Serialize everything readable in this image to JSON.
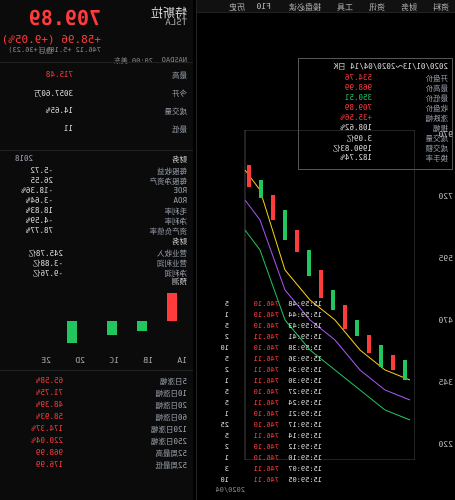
{
  "header": {
    "name": "特斯拉",
    "symbol": "TSLA",
    "price": "709.89",
    "change": "+58.96 (+9.05%)",
    "after_hours": "746.12 +5.10% (+36.23)",
    "after_hours_label": "盘后",
    "market": "NASDAQ",
    "session_time": "20:00 美东"
  },
  "quote_stats": [
    {
      "label": "最高",
      "value": "715.48",
      "cls": "red"
    },
    {
      "label": "今开",
      "value": "3057.60万",
      "cls": "white"
    },
    {
      "label": "成交量",
      "value": "14.65%",
      "cls": "white"
    },
    {
      "label": "最低",
      "value": "11",
      "cls": "white"
    }
  ],
  "chart_toolbar": [
    "资料",
    "财务",
    "资讯",
    "工具",
    "操盘必读",
    "F10",
    "历史"
  ],
  "chart_info": {
    "title": "2020/01/13～2020/04/14 日K",
    "rows": [
      {
        "k": "开盘价",
        "v": "534.76",
        "cls": "red"
      },
      {
        "k": "最高价",
        "v": "968.99",
        "cls": "red"
      },
      {
        "k": "最低价",
        "v": "350.51",
        "cls": "green"
      },
      {
        "k": "收盘价",
        "v": "709.89",
        "cls": "red"
      },
      {
        "k": "涨跌幅",
        "v": "+35.56%",
        "cls": "red"
      },
      {
        "k": "振幅",
        "v": "108.62%",
        "cls": "white"
      },
      {
        "k": "成交量",
        "v": "3.09亿",
        "cls": "white"
      },
      {
        "k": "成交额",
        "v": "1990.83亿",
        "cls": "white"
      },
      {
        "k": "换手率",
        "v": "182.74%",
        "cls": "white"
      }
    ]
  },
  "y_axis": [
    "970",
    "720",
    "595",
    "470",
    "345",
    "220"
  ],
  "x_axis": "2020/04",
  "left_panel": {
    "section1": "财务",
    "year": "2018",
    "fin_rows": [
      {
        "k": "每股收益",
        "v": "-5.72"
      },
      {
        "k": "每股净资产",
        "v": "26.55"
      },
      {
        "k": "ROE",
        "v": "-18.36%"
      },
      {
        "k": "ROA",
        "v": "-3.64%"
      },
      {
        "k": "毛利率",
        "v": "18.83%"
      },
      {
        "k": "净利率",
        "v": "-4.59%"
      },
      {
        "k": "资产负债率",
        "v": "78.77%"
      }
    ],
    "section2": "财务",
    "profit_rows": [
      {
        "k": "营业收入",
        "v": "245.78亿"
      },
      {
        "k": "营业利润",
        "v": "-3.88亿"
      },
      {
        "k": "净利润",
        "v": "-9.76亿"
      }
    ],
    "section3": "预测",
    "forecast_years": [
      "2019",
      "2020",
      "2021",
      "2022"
    ],
    "eps_tabs": [
      "1A",
      "1B",
      "1C",
      "2D",
      "2E"
    ],
    "returns": [
      {
        "k": "5日涨幅",
        "v": "65.58%"
      },
      {
        "k": "10日涨幅",
        "v": "71.75%"
      },
      {
        "k": "20日涨幅",
        "v": "48.39%"
      },
      {
        "k": "60日涨幅",
        "v": "58.93%"
      },
      {
        "k": "120日涨幅",
        "v": "174.37%"
      },
      {
        "k": "250日涨幅",
        "v": "220.04%"
      },
      {
        "k": "52周最高",
        "v": "968.99"
      },
      {
        "k": "52周最低",
        "v": "176.99"
      }
    ]
  },
  "time_sales": [
    {
      "t": "15:59:48",
      "p": "746.10",
      "v": "5"
    },
    {
      "t": "15:59:44",
      "p": "746.10",
      "v": "1"
    },
    {
      "t": "15:59:43",
      "p": "746.10",
      "v": "5"
    },
    {
      "t": "15:59:41",
      "p": "746.11",
      "v": "2"
    },
    {
      "t": "15:59:38",
      "p": "746.10",
      "v": "10"
    },
    {
      "t": "15:59:36",
      "p": "746.11",
      "v": "5"
    },
    {
      "t": "15:59:34",
      "p": "746.11",
      "v": "2"
    },
    {
      "t": "15:59:30",
      "p": "746.11",
      "v": "1"
    },
    {
      "t": "15:59:27",
      "p": "746.10",
      "v": "5"
    },
    {
      "t": "15:59:24",
      "p": "746.11",
      "v": "5"
    },
    {
      "t": "15:59:21",
      "p": "746.10",
      "v": "1"
    },
    {
      "t": "15:59:17",
      "p": "746.10",
      "v": "25"
    },
    {
      "t": "15:59:14",
      "p": "746.11",
      "v": "5"
    },
    {
      "t": "15:59:12",
      "p": "746.10",
      "v": "2"
    },
    {
      "t": "15:59:10",
      "p": "746.10",
      "v": "1"
    },
    {
      "t": "15:59:07",
      "p": "746.11",
      "v": "3"
    },
    {
      "t": "15:59:05",
      "p": "746.11",
      "v": "10"
    }
  ]
}
